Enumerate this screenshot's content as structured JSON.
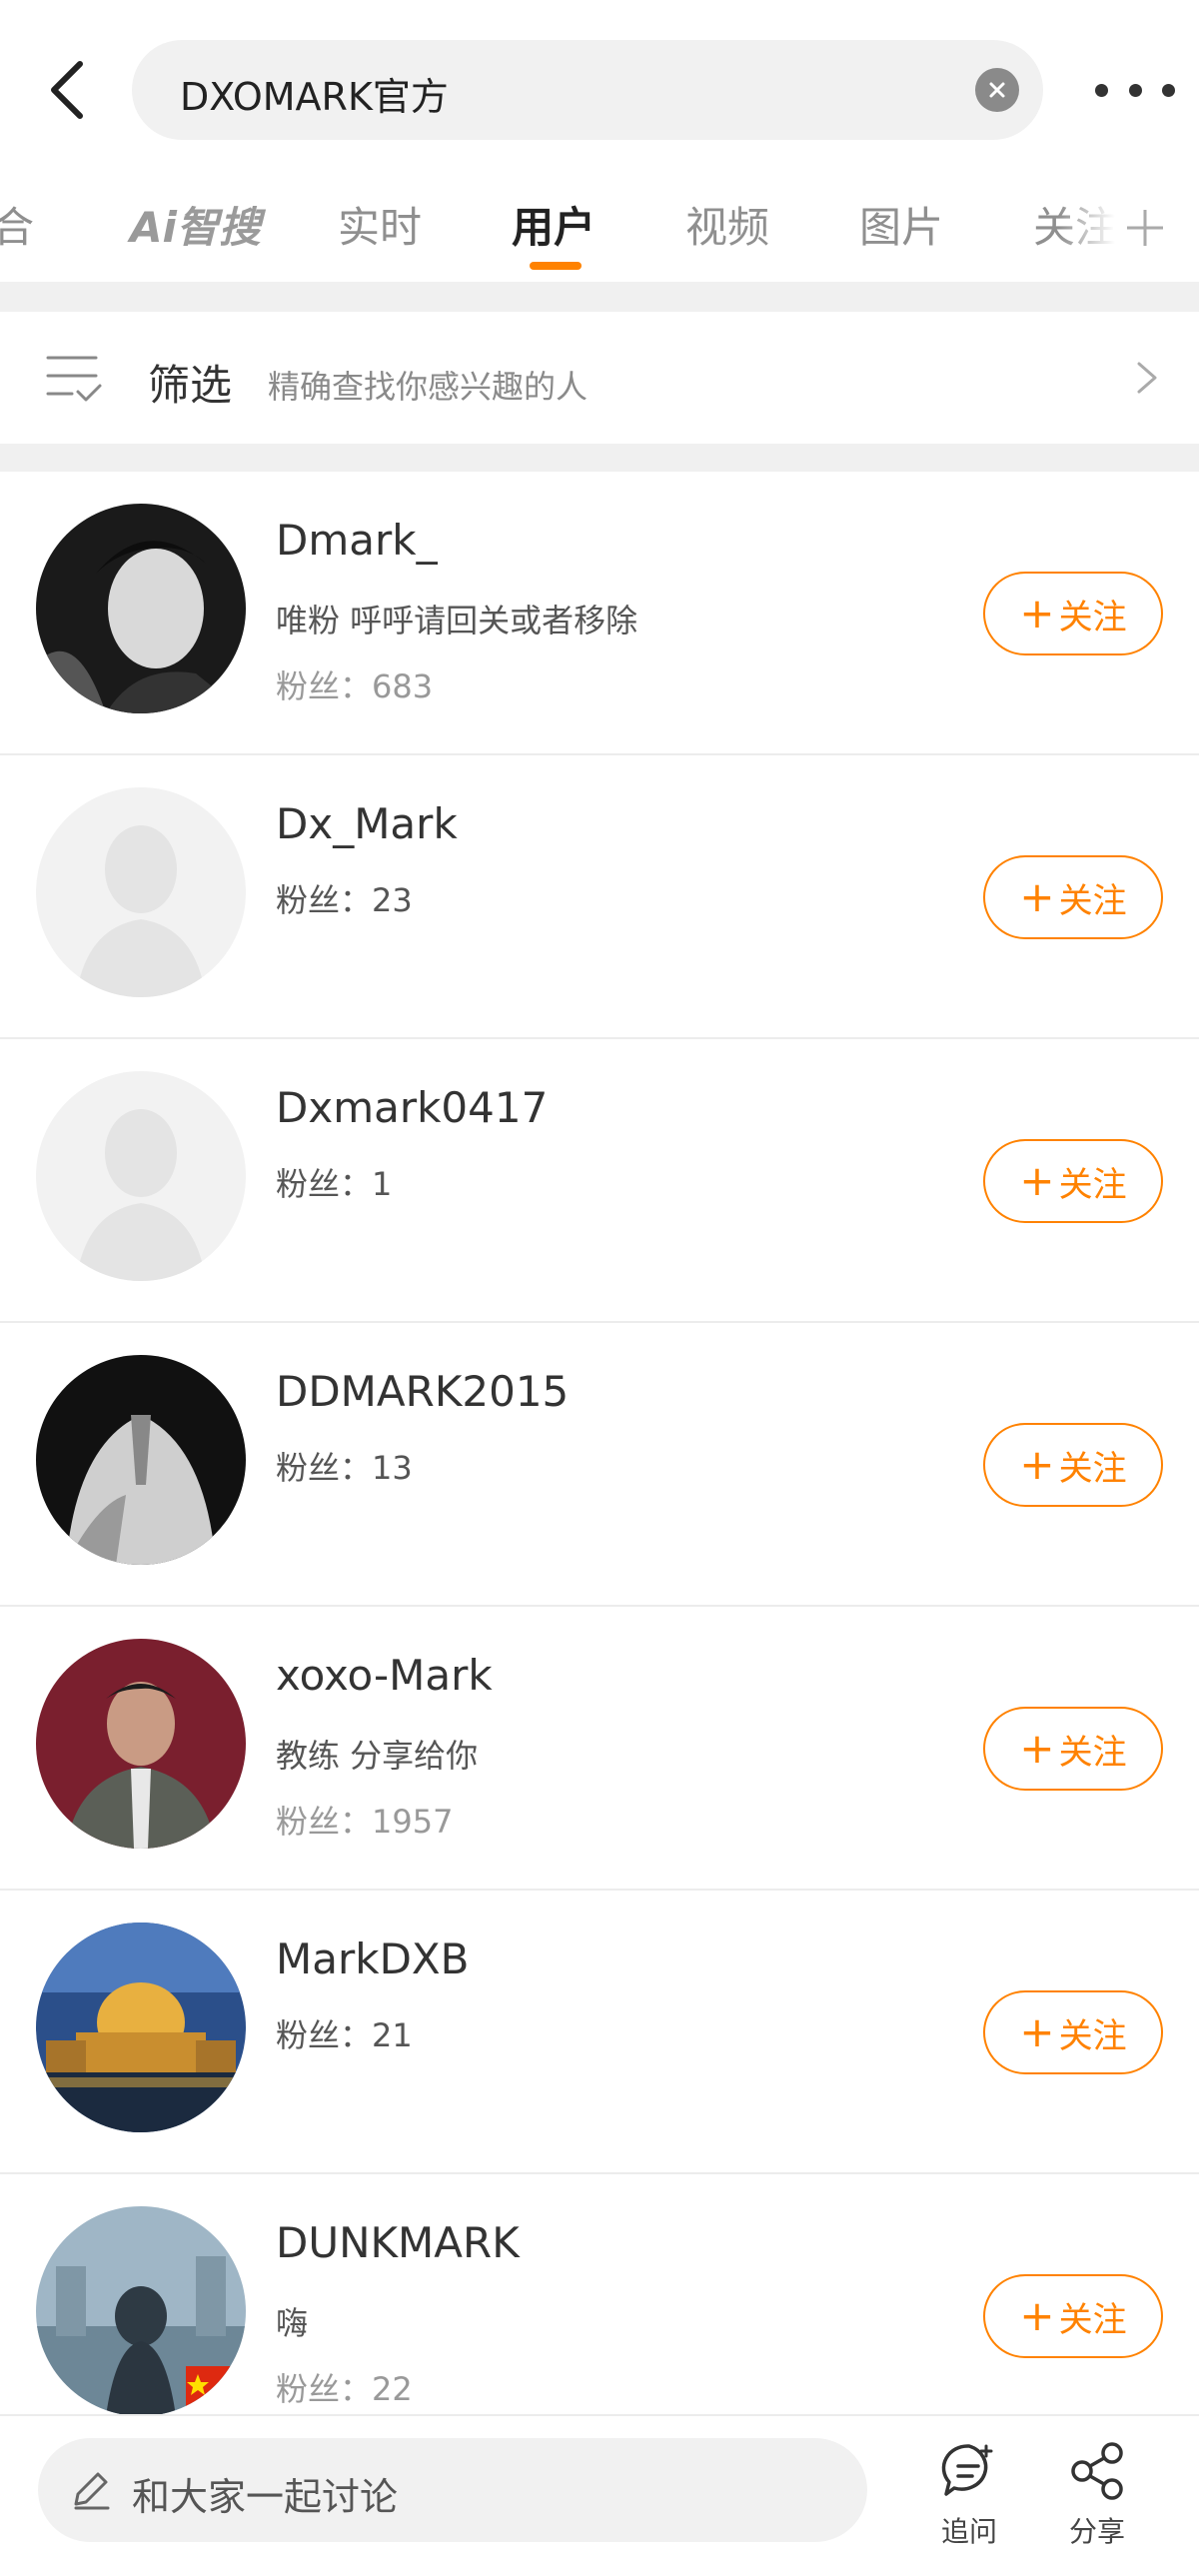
{
  "header": {
    "search_value": "DXOMARK官方"
  },
  "tabs": [
    {
      "label": "合"
    },
    {
      "label": "Ai智搜"
    },
    {
      "label": "实时"
    },
    {
      "label": "用户"
    },
    {
      "label": "视频"
    },
    {
      "label": "图片"
    },
    {
      "label": "关注"
    }
  ],
  "filter": {
    "label": "筛选",
    "description": "精确查找你感兴趣的人"
  },
  "users": [
    {
      "name": "Dmark_",
      "bio": "唯粉  呼呼请回关或者移除",
      "fans": "粉丝：683",
      "follow": "关注"
    },
    {
      "name": "Dx_Mark",
      "bio": "",
      "fans": "粉丝：23",
      "follow": "关注"
    },
    {
      "name": "Dxmark0417",
      "bio": "",
      "fans": "粉丝：1",
      "follow": "关注"
    },
    {
      "name": "DDMARK2015",
      "bio": "",
      "fans": "粉丝：13",
      "follow": "关注"
    },
    {
      "name": "xoxo-Mark",
      "bio": "教练 分享给你",
      "fans": "粉丝：1957",
      "follow": "关注"
    },
    {
      "name": "MarkDXB",
      "bio": "",
      "fans": "粉丝：21",
      "follow": "关注"
    },
    {
      "name": "DUNKMARK",
      "bio": "嗨",
      "fans": "粉丝：22",
      "follow": "关注"
    }
  ],
  "bottom_bar": {
    "comment_placeholder": "和大家一起讨论",
    "ask_label": "追问",
    "share_label": "分享"
  },
  "colors": {
    "accent": "#ff8200",
    "divider": "#f0f0f0"
  }
}
